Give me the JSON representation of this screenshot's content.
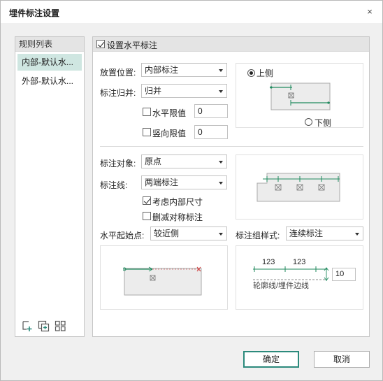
{
  "dialog": {
    "title": "埋件标注设置",
    "close_glyph": "×"
  },
  "rules": {
    "header": "规则列表",
    "items": [
      {
        "label": "内部-默认水...",
        "selected": true
      },
      {
        "label": "外部-默认水...",
        "selected": false
      }
    ],
    "toolbar_icons": [
      "add-rule-icon",
      "copy-rule-icon",
      "manage-rules-icon"
    ]
  },
  "main": {
    "enable_label": "设置水平标注",
    "enable_checked": true,
    "placement_label": "放置位置:",
    "placement_value": "内部标注",
    "merge_label": "标注归并:",
    "merge_value": "归并",
    "h_limit_label": "水平限值",
    "h_limit_value": "0",
    "v_limit_label": "竖向限值",
    "v_limit_value": "0",
    "side_top_label": "上侧",
    "side_bottom_label": "下侧",
    "side_selected": "top",
    "target_label": "标注对象:",
    "target_value": "原点",
    "line_label": "标注线:",
    "line_value": "两端标注",
    "consider_inner_label": "考虑内部尺寸",
    "consider_inner_checked": true,
    "remove_sym_label": "删减对称标注",
    "remove_sym_checked": false,
    "h_start_label": "水平起始点:",
    "h_start_value": "较近侧",
    "group_style_label": "标注组样式:",
    "group_style_value": "连续标注",
    "preview_dim_1": "123",
    "preview_dim_2": "123",
    "preview_offset_value": "10",
    "preview_caption": "轮廓线/埋件边线"
  },
  "buttons": {
    "ok": "确定",
    "cancel": "取消"
  },
  "colors": {
    "accent": "#2c8a7c",
    "dim_line": "#1f8a5e",
    "selection": "#cfe6e1",
    "marker_red": "#d04040"
  }
}
